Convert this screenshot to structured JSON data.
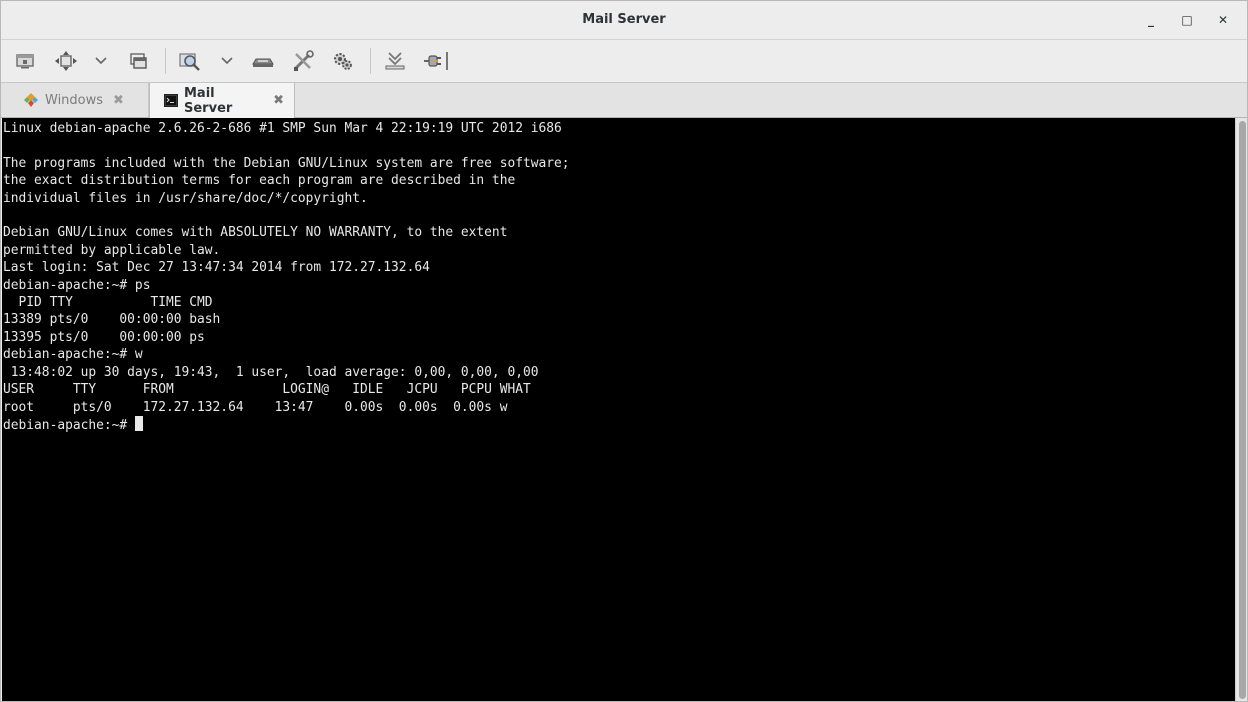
{
  "window": {
    "title": "Mail Server",
    "controls": {
      "minimize": "_",
      "maximize": "□",
      "close": "✕"
    }
  },
  "toolbar": {
    "items": [
      "monitor-icon",
      "move-arrows-icon",
      "chevron-down-icon",
      "windows-icon",
      "zoom-icon",
      "chevron-down-icon",
      "keyboard-icon",
      "tools-icon",
      "settings-gear-icon",
      "download-icon",
      "plug-icon"
    ]
  },
  "tabs": [
    {
      "label": "Windows",
      "icon": "windows-diamond-icon",
      "close": "✖"
    },
    {
      "label": "Mail Server",
      "icon": "terminal-icon",
      "close": "✖",
      "active": true
    }
  ],
  "terminal": {
    "lines": [
      "Linux debian-apache 2.6.26-2-686 #1 SMP Sun Mar 4 22:19:19 UTC 2012 i686",
      "",
      "The programs included with the Debian GNU/Linux system are free software;",
      "the exact distribution terms for each program are described in the",
      "individual files in /usr/share/doc/*/copyright.",
      "",
      "Debian GNU/Linux comes with ABSOLUTELY NO WARRANTY, to the extent",
      "permitted by applicable law.",
      "Last login: Sat Dec 27 13:47:34 2014 from 172.27.132.64",
      "debian-apache:~# ps",
      "  PID TTY          TIME CMD",
      "13389 pts/0    00:00:00 bash",
      "13395 pts/0    00:00:00 ps",
      "debian-apache:~# w",
      " 13:48:02 up 30 days, 19:43,  1 user,  load average: 0,00, 0,00, 0,00",
      "USER     TTY      FROM              LOGIN@   IDLE   JCPU   PCPU WHAT",
      "root     pts/0    172.27.132.64    13:47    0.00s  0.00s  0.00s w"
    ],
    "prompt": "debian-apache:~# "
  },
  "colors": {
    "terminal_bg": "#000000",
    "terminal_fg": "#e8e8e8",
    "chrome_bg": "#ededed"
  }
}
